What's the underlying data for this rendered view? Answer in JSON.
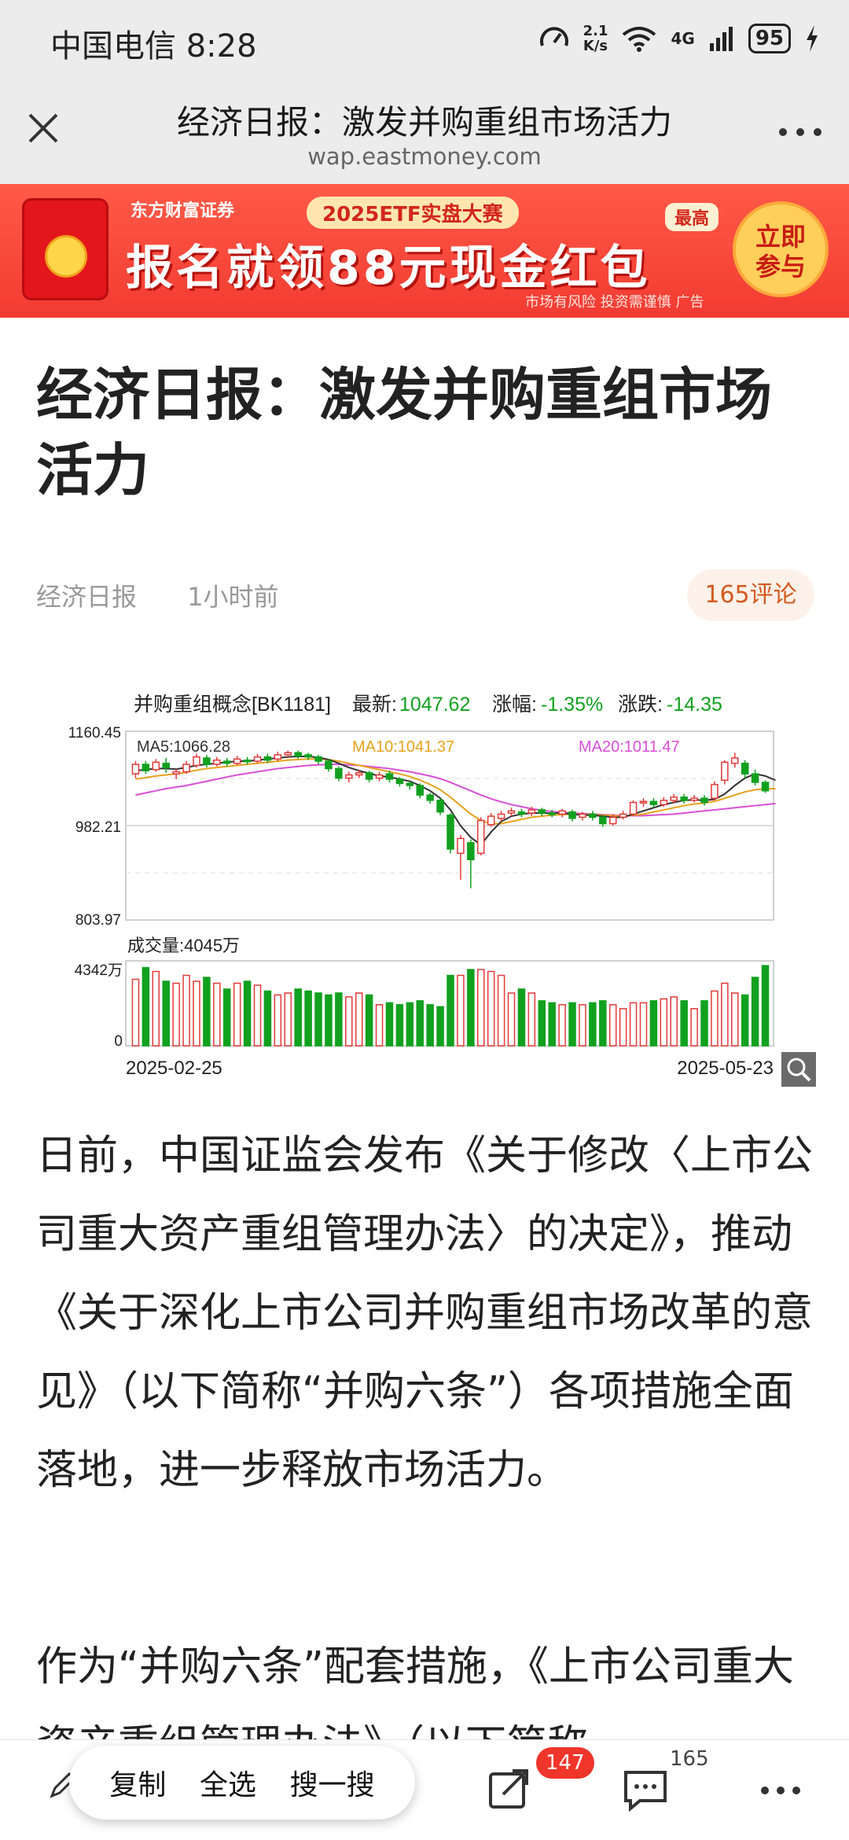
{
  "status_bar": {
    "carrier_time": "中国电信 8:28",
    "speed_top": "2.1",
    "speed_unit": "K/s",
    "network": "4G",
    "battery": "95"
  },
  "title_bar": {
    "title": "经济日报：激发并购重组市场活力",
    "url": "wap.eastmoney.com"
  },
  "ad": {
    "brand": "东方财富证券",
    "subtitle": "2025ETF实盘大赛",
    "headline": "报名就领88元现金红包",
    "badge": "最高",
    "button": "立即参与",
    "disclaimer": "市场有风险 投资需谨慎 广告"
  },
  "article": {
    "headline": "经济日报：激发并购重组市场活力",
    "source": "经济日报",
    "time": "1小时前",
    "comments": "165评论",
    "para1": "日前，中国证监会发布《关于修改〈上市公司重大资产重组管理办法〉的决定》，推动《关于深化上市公司并购重组市场改革的意见》（以下简称“并购六条”）各项措施全面落地，进一步释放市场活力。",
    "para2": "作为“并购六条”配套措施，《上市公司重大资产重组管理办法》（以下简称"
  },
  "chart_data": {
    "type": "candlestick",
    "title": "并购重组概念[BK1181]",
    "latest_label": "最新:",
    "latest": "1047.62",
    "change_pct_label": "涨幅:",
    "change_pct": "-1.35%",
    "change_label": "涨跌:",
    "change": "-14.35",
    "ma5_label": "MA5:1066.28",
    "ma10_label": "MA10:1041.37",
    "ma20_label": "MA20:1011.47",
    "y_ticks": [
      "1160.45",
      "982.21",
      "803.97"
    ],
    "ylim": [
      803.97,
      1160.45
    ],
    "volume_label": "成交量:4045万",
    "volume_ticks": [
      "4342万",
      "0"
    ],
    "volume_max": 4342,
    "x_start": "2025-02-25",
    "x_end": "2025-05-23",
    "colors": {
      "up": "#e23a3a",
      "down": "#11a11f",
      "ma5": "#333333",
      "ma10": "#e8a21c",
      "ma20": "#d94fd6"
    },
    "candles": [
      {
        "o": 1080,
        "c": 1098,
        "h": 1104,
        "l": 1072
      },
      {
        "o": 1098,
        "c": 1086,
        "h": 1104,
        "l": 1080
      },
      {
        "o": 1088,
        "c": 1102,
        "h": 1108,
        "l": 1084
      },
      {
        "o": 1100,
        "c": 1092,
        "h": 1110,
        "l": 1082
      },
      {
        "o": 1080,
        "c": 1084,
        "h": 1090,
        "l": 1070
      },
      {
        "o": 1084,
        "c": 1098,
        "h": 1104,
        "l": 1080
      },
      {
        "o": 1096,
        "c": 1112,
        "h": 1118,
        "l": 1092
      },
      {
        "o": 1110,
        "c": 1098,
        "h": 1116,
        "l": 1092
      },
      {
        "o": 1098,
        "c": 1106,
        "h": 1112,
        "l": 1094
      },
      {
        "o": 1104,
        "c": 1100,
        "h": 1110,
        "l": 1094
      },
      {
        "o": 1100,
        "c": 1108,
        "h": 1114,
        "l": 1096
      },
      {
        "o": 1106,
        "c": 1104,
        "h": 1112,
        "l": 1098
      },
      {
        "o": 1104,
        "c": 1112,
        "h": 1118,
        "l": 1100
      },
      {
        "o": 1112,
        "c": 1106,
        "h": 1118,
        "l": 1100
      },
      {
        "o": 1108,
        "c": 1116,
        "h": 1122,
        "l": 1104
      },
      {
        "o": 1116,
        "c": 1120,
        "h": 1124,
        "l": 1110
      },
      {
        "o": 1120,
        "c": 1114,
        "h": 1124,
        "l": 1108
      },
      {
        "o": 1116,
        "c": 1112,
        "h": 1120,
        "l": 1106
      },
      {
        "o": 1112,
        "c": 1104,
        "h": 1116,
        "l": 1098
      },
      {
        "o": 1104,
        "c": 1090,
        "h": 1108,
        "l": 1084
      },
      {
        "o": 1090,
        "c": 1072,
        "h": 1094,
        "l": 1066
      },
      {
        "o": 1072,
        "c": 1078,
        "h": 1084,
        "l": 1064
      },
      {
        "o": 1078,
        "c": 1082,
        "h": 1088,
        "l": 1072
      },
      {
        "o": 1082,
        "c": 1070,
        "h": 1086,
        "l": 1064
      },
      {
        "o": 1072,
        "c": 1078,
        "h": 1084,
        "l": 1066
      },
      {
        "o": 1080,
        "c": 1070,
        "h": 1086,
        "l": 1064
      },
      {
        "o": 1070,
        "c": 1062,
        "h": 1074,
        "l": 1056
      },
      {
        "o": 1062,
        "c": 1058,
        "h": 1066,
        "l": 1050
      },
      {
        "o": 1058,
        "c": 1040,
        "h": 1062,
        "l": 1034
      },
      {
        "o": 1040,
        "c": 1030,
        "h": 1044,
        "l": 1024
      },
      {
        "o": 1030,
        "c": 1008,
        "h": 1034,
        "l": 1002
      },
      {
        "o": 1002,
        "c": 938,
        "h": 1006,
        "l": 930
      },
      {
        "o": 930,
        "c": 958,
        "h": 964,
        "l": 880
      },
      {
        "o": 950,
        "c": 918,
        "h": 956,
        "l": 864
      },
      {
        "o": 930,
        "c": 992,
        "h": 998,
        "l": 926
      },
      {
        "o": 984,
        "c": 1000,
        "h": 1006,
        "l": 980
      },
      {
        "o": 996,
        "c": 1004,
        "h": 1010,
        "l": 990
      },
      {
        "o": 1006,
        "c": 1010,
        "h": 1016,
        "l": 1000
      },
      {
        "o": 1008,
        "c": 1004,
        "h": 1014,
        "l": 998
      },
      {
        "o": 1006,
        "c": 1012,
        "h": 1018,
        "l": 1000
      },
      {
        "o": 1012,
        "c": 1006,
        "h": 1016,
        "l": 1000
      },
      {
        "o": 1006,
        "c": 1004,
        "h": 1012,
        "l": 998
      },
      {
        "o": 1004,
        "c": 1010,
        "h": 1014,
        "l": 998
      },
      {
        "o": 1008,
        "c": 996,
        "h": 1012,
        "l": 990
      },
      {
        "o": 998,
        "c": 1004,
        "h": 1008,
        "l": 992
      },
      {
        "o": 1004,
        "c": 998,
        "h": 1010,
        "l": 992
      },
      {
        "o": 998,
        "c": 986,
        "h": 1002,
        "l": 980
      },
      {
        "o": 986,
        "c": 998,
        "h": 1004,
        "l": 982
      },
      {
        "o": 998,
        "c": 1004,
        "h": 1010,
        "l": 994
      },
      {
        "o": 1004,
        "c": 1026,
        "h": 1030,
        "l": 1000
      },
      {
        "o": 1026,
        "c": 1028,
        "h": 1034,
        "l": 1018
      },
      {
        "o": 1028,
        "c": 1022,
        "h": 1034,
        "l": 1016
      },
      {
        "o": 1022,
        "c": 1030,
        "h": 1036,
        "l": 1018
      },
      {
        "o": 1030,
        "c": 1036,
        "h": 1042,
        "l": 1024
      },
      {
        "o": 1036,
        "c": 1030,
        "h": 1042,
        "l": 1024
      },
      {
        "o": 1030,
        "c": 1034,
        "h": 1040,
        "l": 1026
      },
      {
        "o": 1034,
        "c": 1026,
        "h": 1040,
        "l": 1020
      },
      {
        "o": 1034,
        "c": 1060,
        "h": 1066,
        "l": 1030
      },
      {
        "o": 1068,
        "c": 1102,
        "h": 1106,
        "l": 1060
      },
      {
        "o": 1100,
        "c": 1110,
        "h": 1120,
        "l": 1092
      },
      {
        "o": 1100,
        "c": 1080,
        "h": 1106,
        "l": 1072
      },
      {
        "o": 1080,
        "c": 1064,
        "h": 1088,
        "l": 1058
      },
      {
        "o": 1064,
        "c": 1048,
        "h": 1068,
        "l": 1044
      }
    ],
    "volumes": [
      3400,
      4000,
      3800,
      3300,
      3200,
      3600,
      3300,
      3500,
      3200,
      2900,
      3200,
      3300,
      3100,
      2800,
      2600,
      2700,
      2900,
      2800,
      2700,
      2600,
      2700,
      2500,
      2700,
      2600,
      2100,
      2200,
      2100,
      2200,
      2300,
      2100,
      2000,
      3600,
      3600,
      3900,
      3900,
      3800,
      3600,
      2700,
      2900,
      2700,
      2300,
      2200,
      2100,
      2200,
      2100,
      2200,
      2300,
      2100,
      1900,
      2200,
      2200,
      2300,
      2400,
      2500,
      2300,
      1900,
      2300,
      2800,
      3200,
      2700,
      2600,
      3500,
      4100,
      4100,
      4045
    ],
    "ma5": [
      1086,
      1088,
      1090,
      1090,
      1089,
      1092,
      1096,
      1098,
      1100,
      1102,
      1104,
      1104,
      1106,
      1108,
      1110,
      1112,
      1113,
      1113,
      1111,
      1107,
      1100,
      1092,
      1086,
      1081,
      1076,
      1074,
      1070,
      1066,
      1058,
      1048,
      1034,
      1012,
      982,
      960,
      946,
      970,
      990,
      1000,
      1004,
      1006,
      1006,
      1006,
      1006,
      1004,
      1002,
      1002,
      1000,
      998,
      998,
      1004,
      1010,
      1016,
      1022,
      1026,
      1030,
      1031,
      1030,
      1032,
      1042,
      1058,
      1072,
      1080,
      1076,
      1068
    ],
    "ma10": [
      1070,
      1073,
      1076,
      1078,
      1080,
      1083,
      1087,
      1090,
      1092,
      1094,
      1096,
      1098,
      1100,
      1102,
      1104,
      1106,
      1107,
      1108,
      1108,
      1107,
      1104,
      1100,
      1096,
      1092,
      1088,
      1084,
      1080,
      1075,
      1068,
      1060,
      1050,
      1036,
      1020,
      1004,
      992,
      986,
      986,
      990,
      994,
      998,
      1000,
      1002,
      1003,
      1004,
      1004,
      1003,
      1002,
      1001,
      1000,
      1002,
      1004,
      1008,
      1012,
      1016,
      1020,
      1023,
      1025,
      1028,
      1034,
      1040,
      1046,
      1050,
      1052,
      1052
    ],
    "ma20": [
      1040,
      1044,
      1048,
      1052,
      1055,
      1058,
      1062,
      1066,
      1070,
      1074,
      1078,
      1081,
      1084,
      1087,
      1090,
      1092,
      1094,
      1096,
      1097,
      1098,
      1098,
      1097,
      1096,
      1094,
      1092,
      1090,
      1087,
      1084,
      1080,
      1076,
      1071,
      1064,
      1056,
      1048,
      1040,
      1033,
      1027,
      1022,
      1018,
      1014,
      1011,
      1009,
      1007,
      1006,
      1005,
      1004,
      1003,
      1002,
      1001,
      1001,
      1001,
      1002,
      1003,
      1004,
      1006,
      1008,
      1010,
      1012,
      1014,
      1016,
      1018,
      1020,
      1022,
      1024
    ]
  },
  "bottom_bar": {
    "copy": "复制",
    "select_all": "全选",
    "search": "搜一搜",
    "share_badge": "147",
    "comment_count": "165"
  }
}
